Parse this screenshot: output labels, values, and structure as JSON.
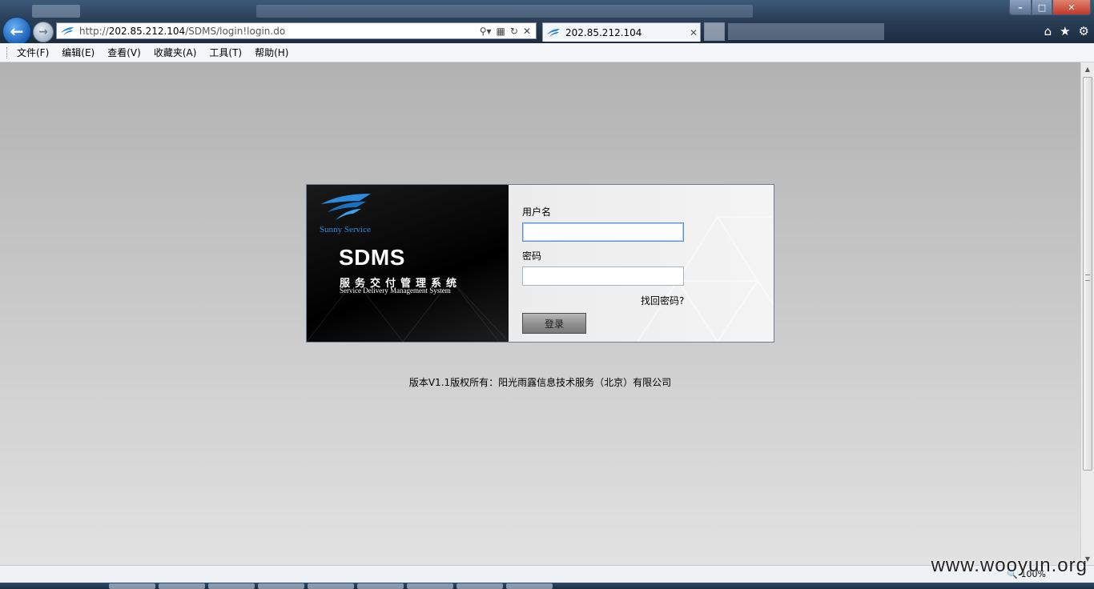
{
  "browser": {
    "address_url_prefix": "http://",
    "address_url_host": "202.85.212.104",
    "address_url_path": "/SDMS/login!login.do",
    "tab_title": "202.85.212.104",
    "zoom": "100%"
  },
  "menu": {
    "items": [
      "文件(F)",
      "编辑(E)",
      "查看(V)",
      "收藏夹(A)",
      "工具(T)",
      "帮助(H)"
    ]
  },
  "brand": {
    "logo_text": "Sunny Service",
    "title": "SDMS",
    "subtitle_cn": "服务交付管理系统",
    "subtitle_en": "Service Delivery Management System"
  },
  "login": {
    "username_label": "用户名",
    "username_value": "",
    "password_label": "密码",
    "password_value": "",
    "forgot_link": "找回密码?",
    "submit_label": "登录"
  },
  "footer": {
    "copyright": "版本V1.1版权所有：阳光雨露信息技术服务（北京）有限公司"
  },
  "watermark": "www.wooyun.org",
  "colors": {
    "brand_blue": "#2b8ad9",
    "brand_bg": "#000000"
  }
}
